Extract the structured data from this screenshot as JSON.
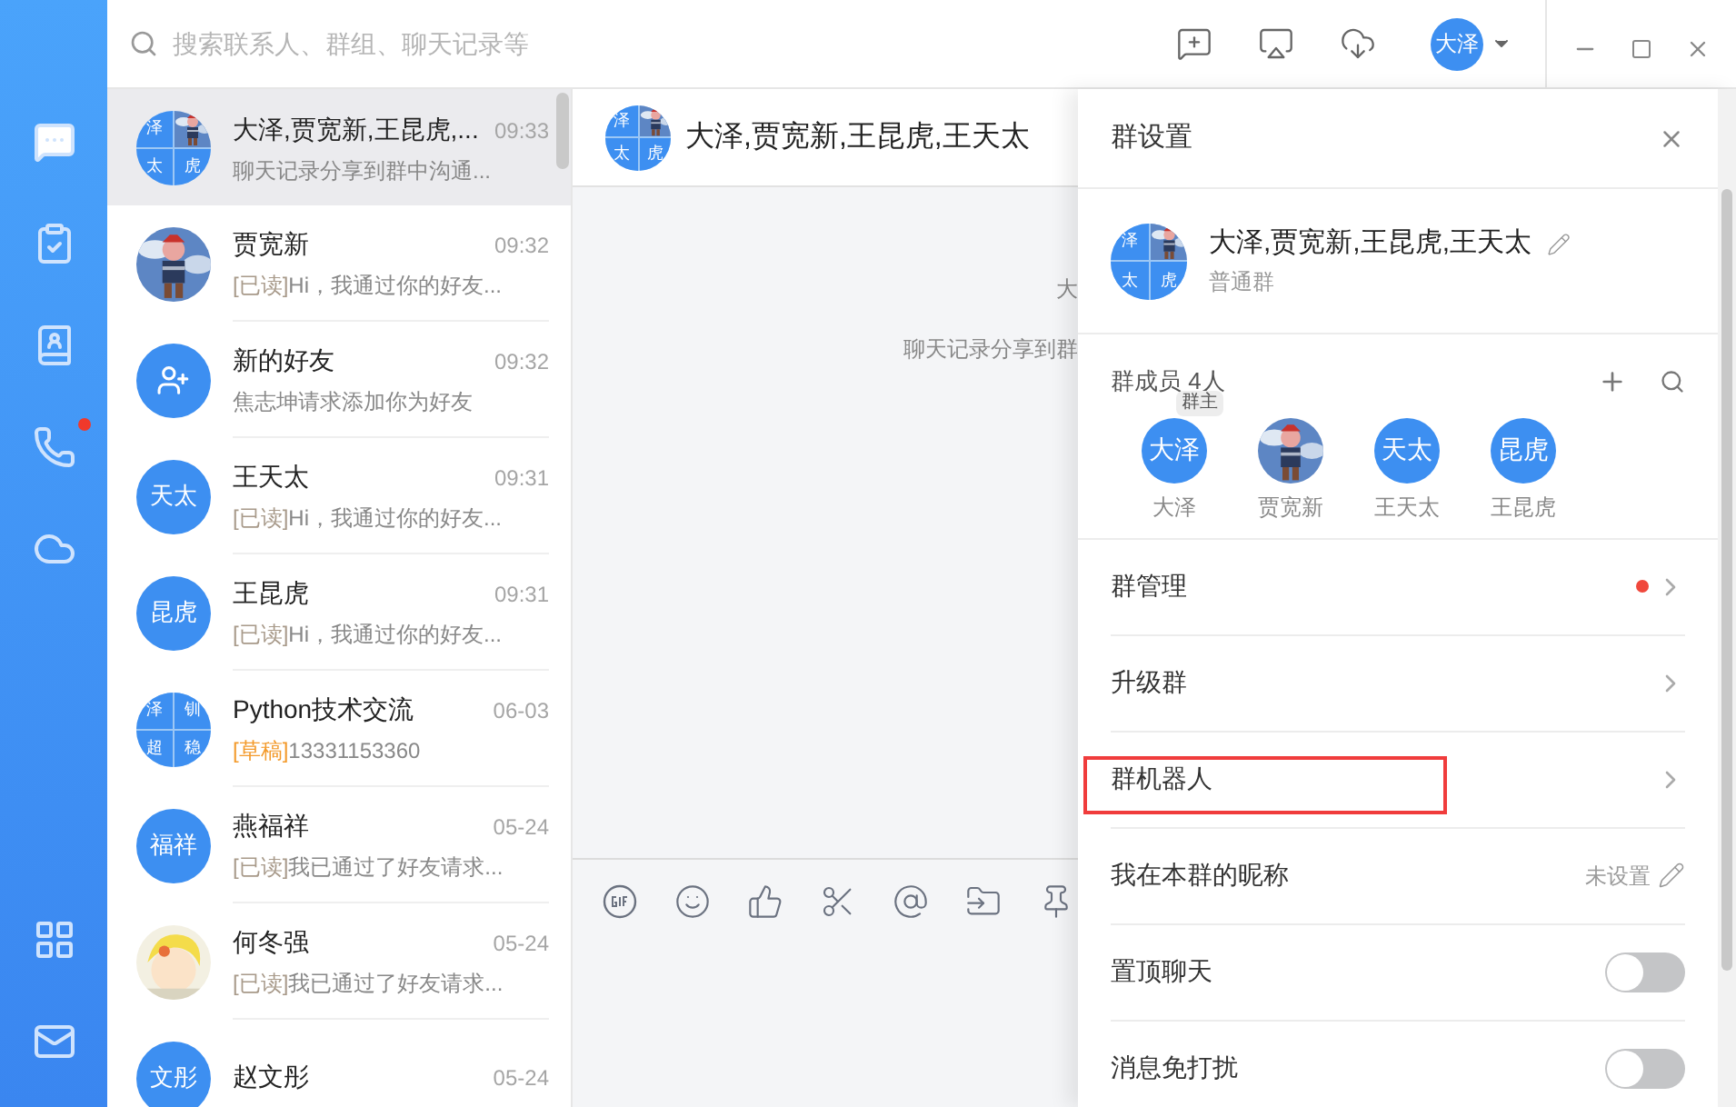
{
  "search": {
    "placeholder": "搜索联系人、群组、聊天记录等"
  },
  "rail": [
    {
      "kind": "chat",
      "badge": false
    },
    {
      "kind": "task",
      "badge": false
    },
    {
      "kind": "contacts",
      "badge": false
    },
    {
      "kind": "phone",
      "badge": true
    },
    {
      "kind": "cloud",
      "badge": false
    }
  ],
  "rail_bottom": [
    {
      "kind": "apps"
    },
    {
      "kind": "mail"
    }
  ],
  "user": {
    "initials": "大泽"
  },
  "chats": [
    {
      "name": "大泽,贾宽新,王昆虎,...",
      "time": "09:33",
      "preview": "聊天记录分享到群中沟通...",
      "selected": true,
      "avatar": {
        "kind": "group",
        "cells": [
          "泽",
          "",
          "太",
          "虎"
        ]
      }
    },
    {
      "name": "贾宽新",
      "time": "09:32",
      "tag": {
        "text": "[已读]",
        "kind": "read"
      },
      "preview": "Hi，我通过你的好友...",
      "selected": false
    },
    {
      "name": "新的好友",
      "time": "09:32",
      "preview": "焦志坤请求添加你为好友",
      "selected": false,
      "avatar": {
        "kind": "add-friend"
      }
    },
    {
      "name": "王天太",
      "time": "09:31",
      "tag": {
        "text": "[已读]",
        "kind": "read"
      },
      "preview": "Hi，我通过你的好友...",
      "selected": false,
      "avatar": {
        "kind": "text",
        "text": "天太"
      }
    },
    {
      "name": "王昆虎",
      "time": "09:31",
      "tag": {
        "text": "[已读]",
        "kind": "read"
      },
      "preview": "Hi，我通过你的好友...",
      "selected": false,
      "avatar": {
        "kind": "text",
        "text": "昆虎"
      }
    },
    {
      "name": "Python技术交流",
      "time": "06-03",
      "tag": {
        "text": "[草稿]",
        "kind": "draft"
      },
      "preview": "13331153360",
      "selected": false,
      "avatar": {
        "kind": "group",
        "cells": [
          "泽",
          "钏",
          "超",
          "稳"
        ]
      }
    },
    {
      "name": "燕福祥",
      "time": "05-24",
      "tag": {
        "text": "[已读]",
        "kind": "read"
      },
      "preview": "我已通过了好友请求...",
      "selected": false,
      "avatar": {
        "kind": "text",
        "text": "福祥"
      }
    },
    {
      "name": "何冬强",
      "time": "05-24",
      "tag": {
        "text": "[已读]",
        "kind": "read"
      },
      "preview": "我已通过了好友请求...",
      "selected": false,
      "avatar": {
        "kind": "cartoon"
      }
    },
    {
      "name": "赵文彤",
      "time": "05-24",
      "selected": false,
      "avatar": {
        "kind": "text",
        "text": "文彤"
      }
    }
  ],
  "conversation": {
    "title": "大泽,贾宽新,王昆虎,王天太",
    "avatar": {
      "kind": "group",
      "cells": [
        "泽",
        "",
        "太",
        "虎"
      ]
    },
    "messages": [
      "大",
      "聊天记录分享到群"
    ],
    "toolbar": [
      {
        "kind": "gif"
      },
      {
        "kind": "emoji"
      },
      {
        "kind": "like"
      },
      {
        "kind": "screenshot"
      },
      {
        "kind": "mention"
      },
      {
        "kind": "file"
      },
      {
        "kind": "pin"
      }
    ]
  },
  "settings": {
    "title": "群设置",
    "group_name": "大泽,贾宽新,王昆虎,王天太",
    "group_type": "普通群",
    "avatar": {
      "kind": "group",
      "cells": [
        "泽",
        "",
        "太",
        "虎"
      ]
    },
    "members_label": "群成员 4人",
    "members": [
      {
        "name": "大泽",
        "avatar": {
          "kind": "text",
          "text": "大泽"
        },
        "badge": "群主"
      },
      {
        "name": "贾宽新"
      },
      {
        "name": "王天太",
        "avatar": {
          "kind": "text",
          "text": "天太"
        }
      },
      {
        "name": "王昆虎",
        "avatar": {
          "kind": "text",
          "text": "昆虎"
        }
      }
    ],
    "rows": [
      {
        "kind": "link",
        "label": "群管理",
        "dot": true,
        "highlighted": false
      },
      {
        "kind": "link",
        "label": "升级群",
        "dot": false,
        "highlighted": false
      },
      {
        "kind": "link",
        "label": "群机器人",
        "dot": false,
        "highlighted": true
      },
      {
        "kind": "value",
        "label": "我在本群的昵称",
        "value": "未设置",
        "highlighted": false
      },
      {
        "kind": "toggle",
        "label": "置顶聊天",
        "on": false,
        "highlighted": false
      },
      {
        "kind": "toggle",
        "label": "消息免打扰",
        "on": false,
        "highlighted": false
      }
    ]
  }
}
